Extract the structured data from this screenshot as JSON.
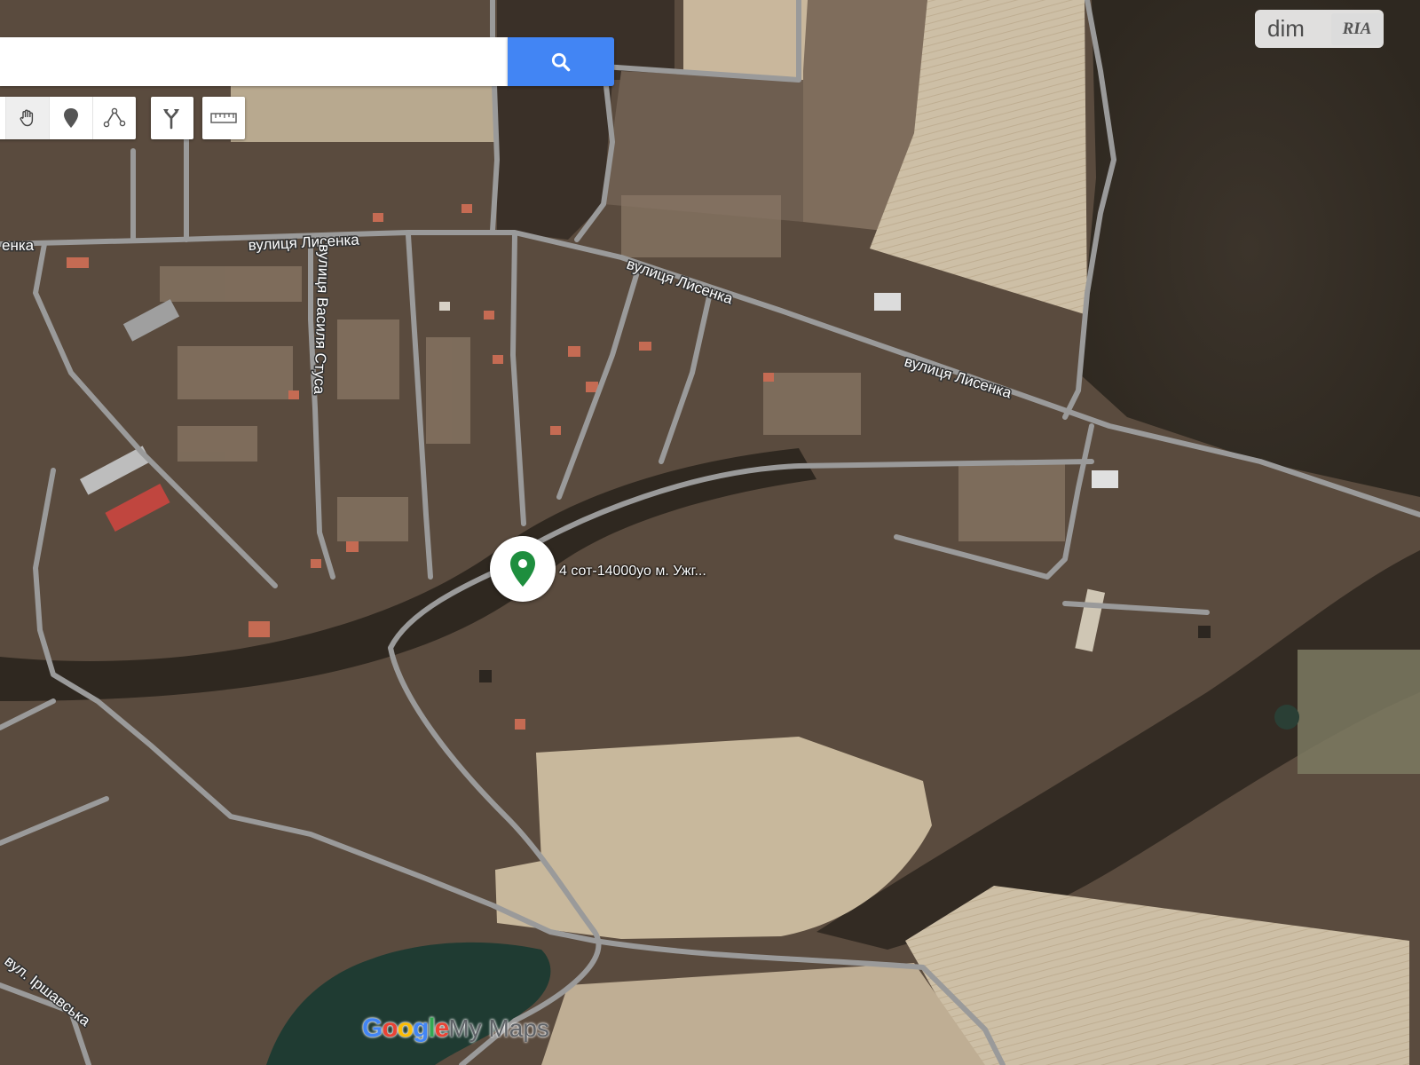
{
  "search": {
    "value": "",
    "placeholder": ""
  },
  "toolbar": {
    "tools": [
      {
        "name": "hand-tool",
        "icon": "hand-icon",
        "active": true
      },
      {
        "name": "add-marker-tool",
        "icon": "marker-icon"
      },
      {
        "name": "draw-line-tool",
        "icon": "line-icon"
      },
      {
        "name": "directions-tool",
        "icon": "directions-icon"
      },
      {
        "name": "measure-tool",
        "icon": "ruler-icon"
      }
    ]
  },
  "map": {
    "street_labels": {
      "lysenka_left": "енка",
      "lysenka_1": "вулиця Лисенка",
      "lysenka_2": "вулиця Лисенка",
      "lysenka_3": "вулиця Лисенка",
      "stusa": "вулиця Василя Стуса",
      "irshavska": "вул. Іршавська"
    },
    "marker": {
      "label": "4 сот-14000уо  м. Ужг...",
      "color": "#1e8e3e"
    }
  },
  "branding": {
    "dim": "dim",
    "ria": "RIA",
    "google": [
      "G",
      "o",
      "o",
      "g",
      "l",
      "e"
    ],
    "mymaps": "My Maps"
  },
  "colors": {
    "accent": "#4285f4",
    "road": "#9a9a9a",
    "water": "#1f3b32"
  }
}
